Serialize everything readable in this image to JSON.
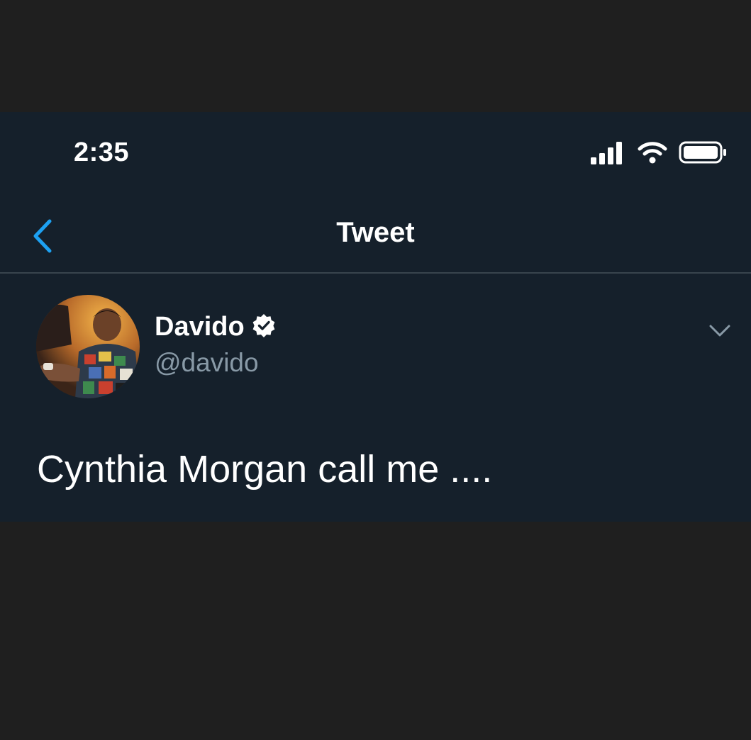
{
  "status_bar": {
    "time": "2:35",
    "icons": [
      "signal-icon",
      "wifi-icon",
      "battery-icon"
    ]
  },
  "nav": {
    "back_icon": "chevron-left-icon",
    "title": "Tweet"
  },
  "tweet": {
    "author": {
      "display_name": "Davido",
      "handle": "@davido",
      "verified": true,
      "avatar": "avatar-photo"
    },
    "more_icon": "chevron-down-icon",
    "text": "Cynthia Morgan call me ...."
  },
  "colors": {
    "outer_background": "#1f1f1f",
    "app_background": "#15202b",
    "accent": "#1da1f2",
    "secondary_text": "#8899a6",
    "divider": "#38444d"
  }
}
